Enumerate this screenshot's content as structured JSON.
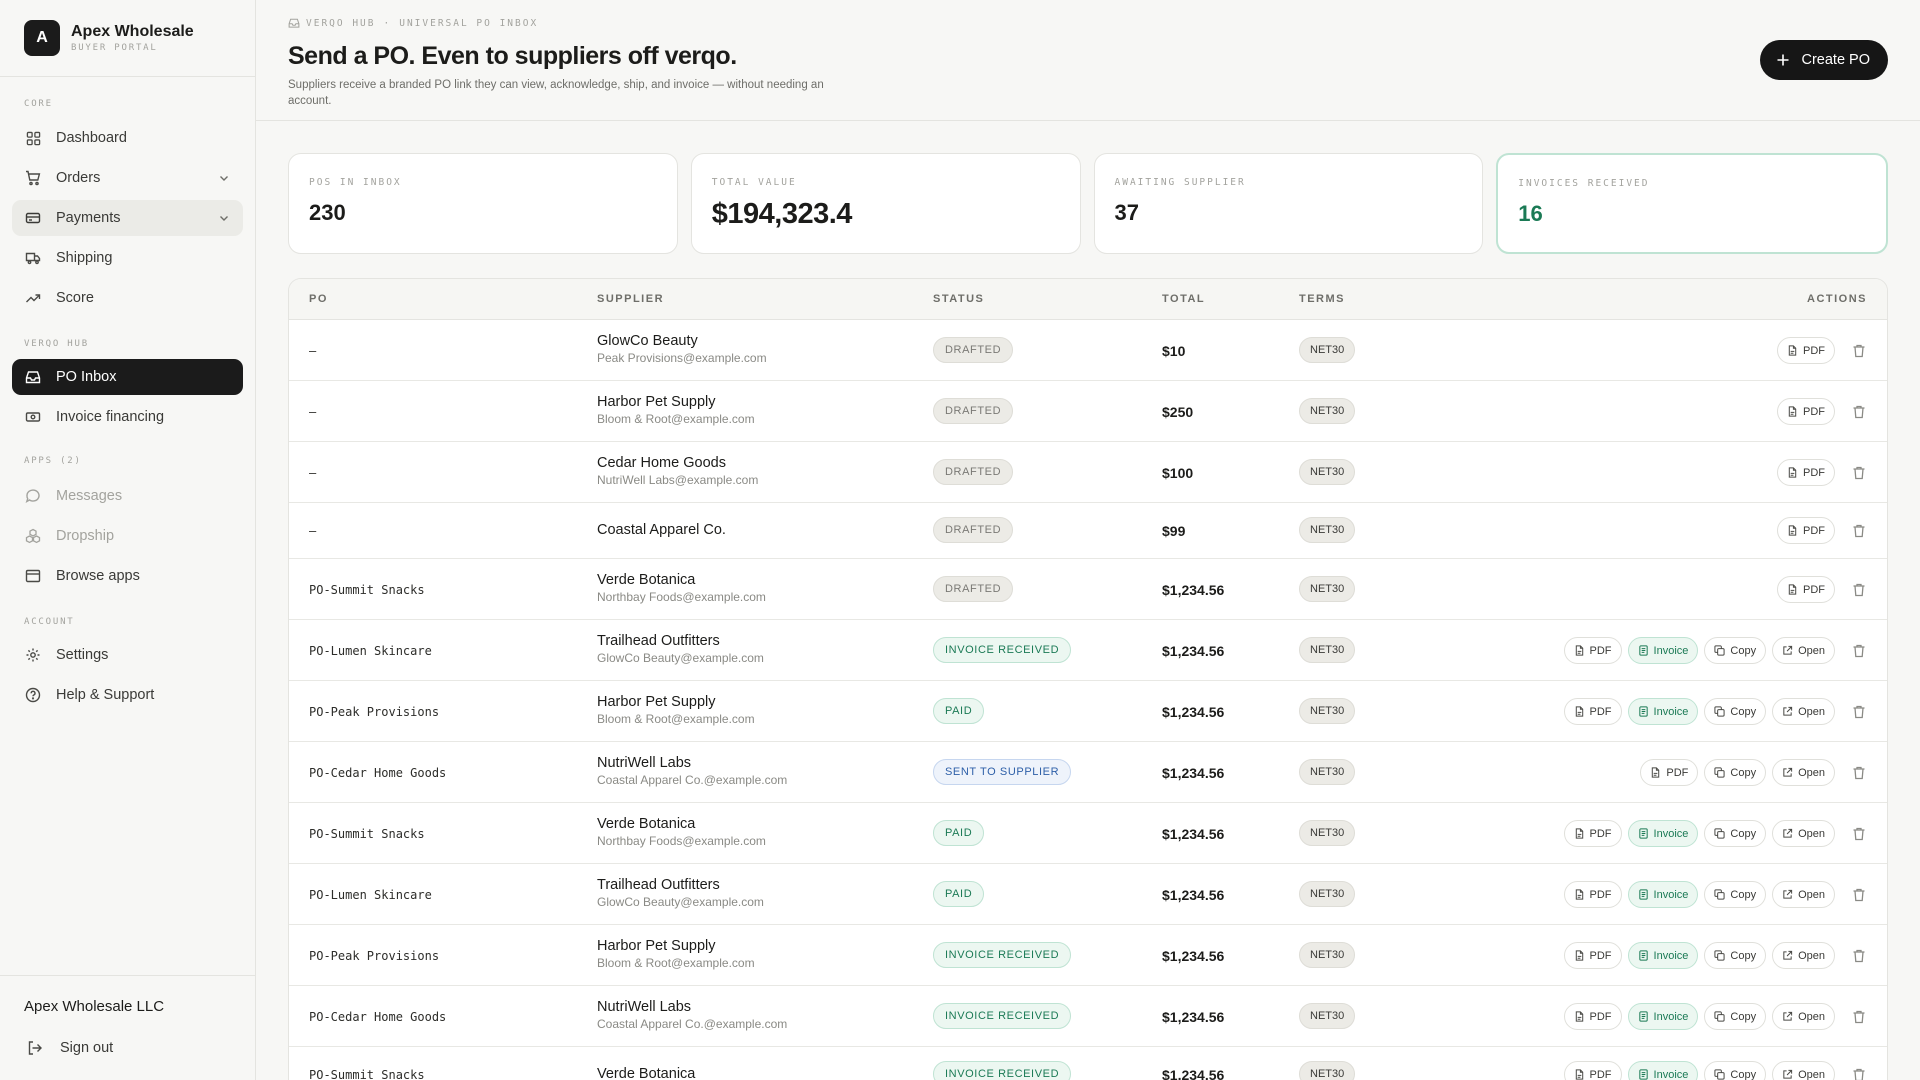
{
  "brand": {
    "initial": "A",
    "name": "Apex Wholesale",
    "subtitle": "BUYER PORTAL"
  },
  "sidebar": {
    "sections": {
      "core": "CORE",
      "hub": "VERQO HUB",
      "apps": "APPS  (2)",
      "account": "ACCOUNT"
    },
    "items": {
      "dashboard": "Dashboard",
      "orders": "Orders",
      "payments": "Payments",
      "shipping": "Shipping",
      "score": "Score",
      "po_inbox": "PO Inbox",
      "invoice_financing": "Invoice financing",
      "messages": "Messages",
      "dropship": "Dropship",
      "browse_apps": "Browse apps",
      "settings": "Settings",
      "help": "Help & Support"
    },
    "footer": {
      "company": "Apex Wholesale LLC",
      "sign_out": "Sign out"
    }
  },
  "header": {
    "breadcrumb_1": "VERQO HUB",
    "breadcrumb_sep": "·",
    "breadcrumb_2": "UNIVERSAL PO INBOX",
    "title": "Send a PO. Even to suppliers off verqo.",
    "subtitle": "Suppliers receive a branded PO link they can view, acknowledge, ship, and invoice — without needing an account.",
    "create_button": "Create PO"
  },
  "stats": [
    {
      "label": "POS IN INBOX",
      "value": "230"
    },
    {
      "label": "TOTAL VALUE",
      "value": "$194,323.4"
    },
    {
      "label": "AWAITING SUPPLIER",
      "value": "37"
    },
    {
      "label": "INVOICES RECEIVED",
      "value": "16"
    }
  ],
  "table": {
    "columns": {
      "po": "PO",
      "supplier": "SUPPLIER",
      "status": "STATUS",
      "total": "TOTAL",
      "terms": "TERMS",
      "actions": "ACTIONS"
    },
    "action_labels": {
      "pdf": "PDF",
      "invoice": "Invoice",
      "copy": "Copy",
      "open": "Open"
    },
    "rows": [
      {
        "po": "–",
        "supplier": "GlowCo Beauty",
        "email": "Peak Provisions@example.com",
        "status": "DRAFTED",
        "status_kind": "drafted",
        "total": "$10",
        "terms": "NET30",
        "actions": [
          "pdf"
        ]
      },
      {
        "po": "–",
        "supplier": "Harbor Pet Supply",
        "email": "Bloom & Root@example.com",
        "status": "DRAFTED",
        "status_kind": "drafted",
        "total": "$250",
        "terms": "NET30",
        "actions": [
          "pdf"
        ]
      },
      {
        "po": "–",
        "supplier": "Cedar Home Goods",
        "email": "NutriWell Labs@example.com",
        "status": "DRAFTED",
        "status_kind": "drafted",
        "total": "$100",
        "terms": "NET30",
        "actions": [
          "pdf"
        ]
      },
      {
        "po": "–",
        "supplier": "Coastal Apparel Co.",
        "email": "",
        "status": "DRAFTED",
        "status_kind": "drafted",
        "total": "$99",
        "terms": "NET30",
        "actions": [
          "pdf"
        ]
      },
      {
        "po": "PO-Summit Snacks",
        "supplier": "Verde Botanica",
        "email": "Northbay Foods@example.com",
        "status": "DRAFTED",
        "status_kind": "drafted",
        "total": "$1,234.56",
        "terms": "NET30",
        "actions": [
          "pdf"
        ]
      },
      {
        "po": "PO-Lumen Skincare",
        "supplier": "Trailhead Outfitters",
        "email": "GlowCo Beauty@example.com",
        "status": "INVOICE RECEIVED",
        "status_kind": "inv",
        "total": "$1,234.56",
        "terms": "NET30",
        "actions": [
          "pdf",
          "invoice",
          "copy",
          "open"
        ]
      },
      {
        "po": "PO-Peak Provisions",
        "supplier": "Harbor Pet Supply",
        "email": "Bloom & Root@example.com",
        "status": "PAID",
        "status_kind": "paid",
        "total": "$1,234.56",
        "terms": "NET30",
        "actions": [
          "pdf",
          "invoice",
          "copy",
          "open"
        ]
      },
      {
        "po": "PO-Cedar Home Goods",
        "supplier": "NutriWell Labs",
        "email": "Coastal Apparel Co.@example.com",
        "status": "SENT TO SUPPLIER",
        "status_kind": "sent",
        "total": "$1,234.56",
        "terms": "NET30",
        "actions": [
          "pdf",
          "copy",
          "open"
        ]
      },
      {
        "po": "PO-Summit Snacks",
        "supplier": "Verde Botanica",
        "email": "Northbay Foods@example.com",
        "status": "PAID",
        "status_kind": "paid",
        "total": "$1,234.56",
        "terms": "NET30",
        "actions": [
          "pdf",
          "invoice",
          "copy",
          "open"
        ]
      },
      {
        "po": "PO-Lumen Skincare",
        "supplier": "Trailhead Outfitters",
        "email": "GlowCo Beauty@example.com",
        "status": "PAID",
        "status_kind": "paid",
        "total": "$1,234.56",
        "terms": "NET30",
        "actions": [
          "pdf",
          "invoice",
          "copy",
          "open"
        ]
      },
      {
        "po": "PO-Peak Provisions",
        "supplier": "Harbor Pet Supply",
        "email": "Bloom & Root@example.com",
        "status": "INVOICE RECEIVED",
        "status_kind": "inv",
        "total": "$1,234.56",
        "terms": "NET30",
        "actions": [
          "pdf",
          "invoice",
          "copy",
          "open"
        ]
      },
      {
        "po": "PO-Cedar Home Goods",
        "supplier": "NutriWell Labs",
        "email": "Coastal Apparel Co.@example.com",
        "status": "INVOICE RECEIVED",
        "status_kind": "inv",
        "total": "$1,234.56",
        "terms": "NET30",
        "actions": [
          "pdf",
          "invoice",
          "copy",
          "open"
        ]
      },
      {
        "po": "PO-Summit Snacks",
        "supplier": "Verde Botanica",
        "email": "",
        "status": "INVOICE RECEIVED",
        "status_kind": "inv",
        "total": "$1,234.56",
        "terms": "NET30",
        "actions": [
          "pdf",
          "invoice",
          "copy",
          "open"
        ]
      }
    ]
  },
  "colors": {
    "accent_dark": "#161616",
    "success": "#1b7a55",
    "success_bg": "#ecf7f1",
    "info": "#2d5fa8"
  }
}
